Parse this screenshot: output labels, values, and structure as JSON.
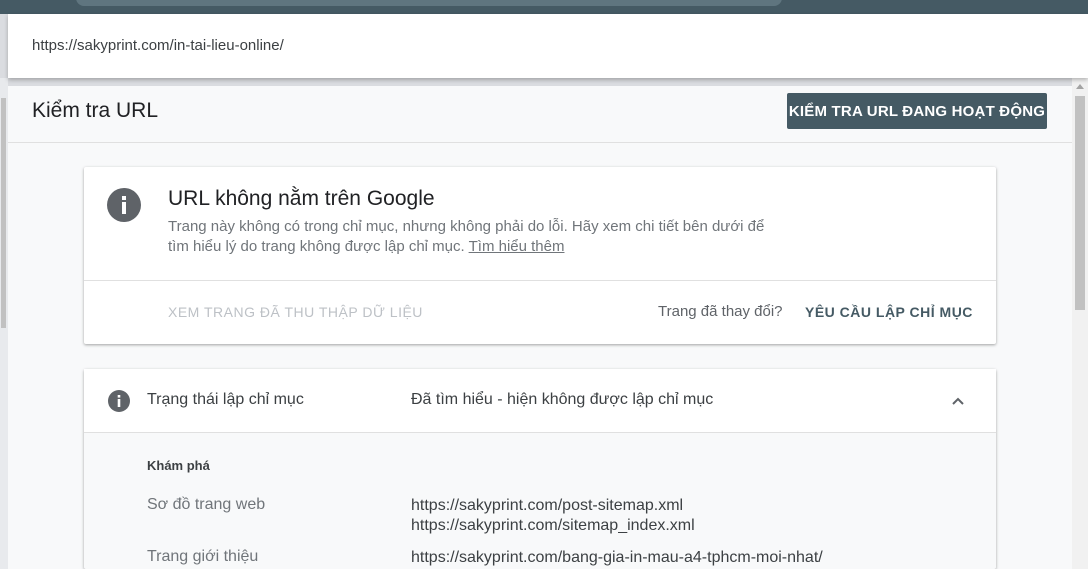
{
  "url_bar": {
    "url": "https://sakyprint.com/in-tai-lieu-online/"
  },
  "header": {
    "title": "Kiểm tra URL",
    "live_test_label": "KIỂM TRA URL ĐANG HOẠT ĐỘNG"
  },
  "summary_card": {
    "icon": "info-icon",
    "heading": "URL không nằm trên Google",
    "description": "Trang này không có trong chỉ mục, nhưng không phải do lỗi. Hãy xem chi tiết bên dưới để tìm hiểu lý do trang không được lập chỉ mục.",
    "learn_more": "Tìm hiểu thêm",
    "view_crawled_label": "XEM TRANG ĐÃ THU THẬP DỮ LIỆU",
    "page_changed_label": "Trang đã thay đổi?",
    "request_indexing_label": "YÊU CẦU LẬP CHỈ MỤC"
  },
  "coverage_card": {
    "icon": "info-icon",
    "status_label": "Trạng thái lập chỉ mục",
    "status_value": "Đã tìm hiểu - hiện không được lập chỉ mục",
    "section_title": "Khám phá",
    "sitemaps_label": "Sơ đồ trang web",
    "sitemaps": [
      "https://sakyprint.com/post-sitemap.xml",
      "https://sakyprint.com/sitemap_index.xml"
    ],
    "referring_label": "Trang giới thiệu",
    "referring_value": "https://sakyprint.com/bang-gia-in-mau-a4-tphcm-moi-nhat/"
  },
  "colors": {
    "top_bar": "#455a64",
    "button_bg": "#455a64",
    "icon_grey": "#5f6368"
  }
}
